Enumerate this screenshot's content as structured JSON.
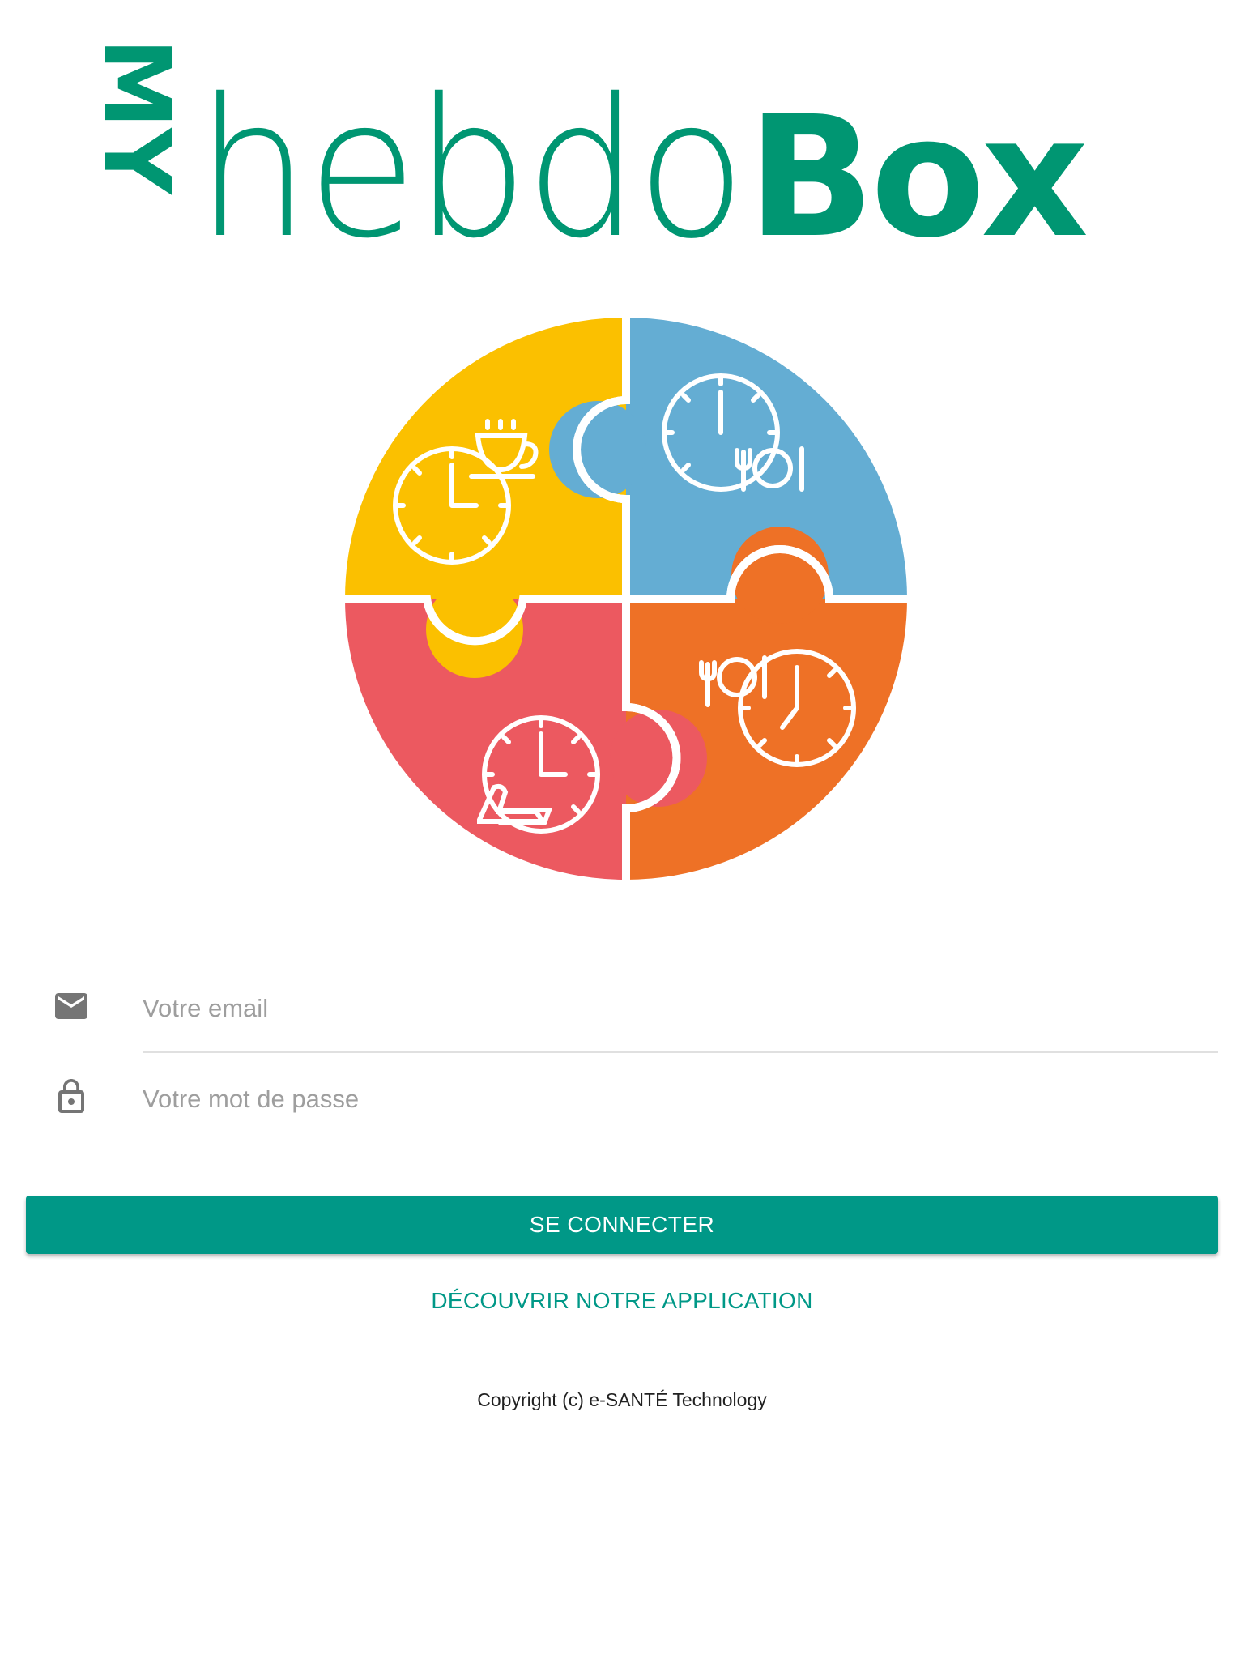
{
  "brand": {
    "logo_prefix": "MY",
    "logo_main": "hebdo",
    "logo_suffix": "Box",
    "logo_color": "#009672"
  },
  "puzzle": {
    "pieces": [
      {
        "name": "morning",
        "color": "#FBC000",
        "icon": "clock-coffee-icon"
      },
      {
        "name": "lunch",
        "color": "#64ADD3",
        "icon": "clock-plate-icon"
      },
      {
        "name": "afternoon",
        "color": "#EC5960",
        "icon": "clock-reading-icon"
      },
      {
        "name": "evening",
        "color": "#EE7126",
        "icon": "clock-dinner-icon"
      }
    ]
  },
  "form": {
    "email_placeholder": "Votre email",
    "email_icon": "email-icon",
    "password_placeholder": "Votre mot de passe",
    "password_icon": "lock-icon",
    "submit_label": "SE CONNECTER",
    "discover_label": "DÉCOUVRIR NOTRE APPLICATION",
    "accent_color": "#009887",
    "icon_color": "#757575"
  },
  "footer": {
    "copyright": "Copyright (c) e-SANTÉ Technology"
  }
}
